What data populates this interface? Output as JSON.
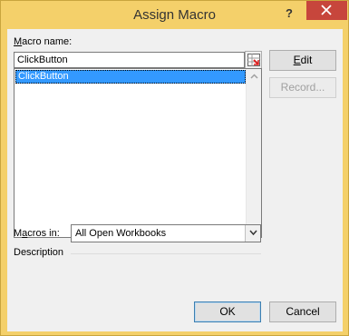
{
  "window": {
    "title": "Assign Macro",
    "help_glyph": "?",
    "close_glyph": "x"
  },
  "macro_name": {
    "label_underlined": "M",
    "label_rest": "acro name:",
    "value": "ClickButton"
  },
  "macro_list": {
    "items": [
      "ClickButton"
    ],
    "selected": 0
  },
  "buttons": {
    "edit_underlined": "E",
    "edit_rest": "dit",
    "record": "Record...",
    "ok": "OK",
    "cancel": "Cancel"
  },
  "macros_in": {
    "label_pre": "M",
    "label_underlined": "a",
    "label_rest": "cros in:",
    "value": "All Open Workbooks"
  },
  "description": {
    "label": "Description",
    "text": ""
  },
  "colors": {
    "title_bar": "#f4d06a",
    "close_button": "#c7463c",
    "selection": "#3399ff"
  }
}
